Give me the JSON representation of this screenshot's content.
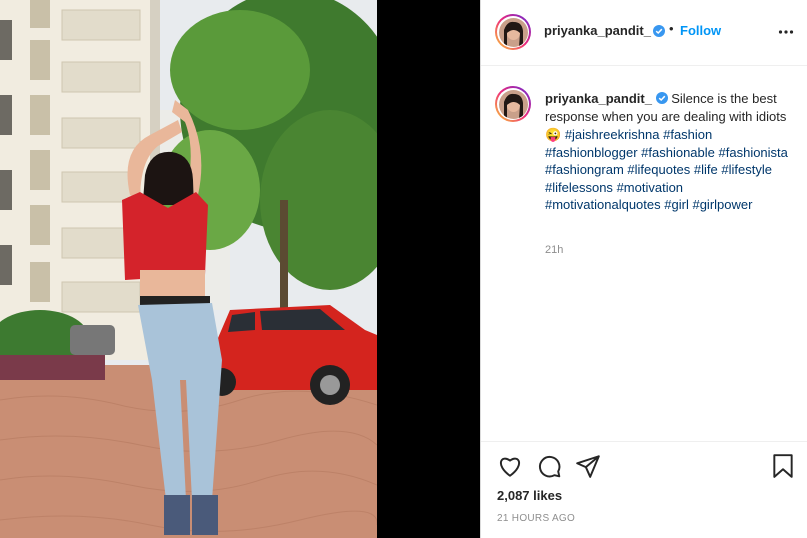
{
  "post": {
    "username": "priyanka_pandit_",
    "follow_label": "Follow",
    "separator": "•",
    "caption_prefix": "Silence is the best response when you are dealing with idiots ",
    "caption_emoji": "😜",
    "hashtags": [
      "#jaishreekrishna",
      "#fashion",
      "#fashionblogger",
      "#fashionable",
      "#fashionista",
      "#fashiongram",
      "#lifequotes",
      "#life",
      "#lifestyle",
      "#lifelessons",
      "#motivation",
      "#motivationalquotes",
      "#girl",
      "#girlpower"
    ],
    "comment_age": "21h",
    "likes": "2,087 likes",
    "posted_ago": "21 HOURS AGO"
  },
  "icons": {
    "verified": "verified-badge-icon",
    "more": "more-options-icon",
    "like": "heart-icon",
    "comment": "comment-icon",
    "share": "paper-plane-icon",
    "save": "bookmark-icon"
  },
  "colors": {
    "follow": "#0095f6",
    "hashtag": "#00376b",
    "verified": "#3897f0",
    "muted": "#8e8e8e"
  }
}
